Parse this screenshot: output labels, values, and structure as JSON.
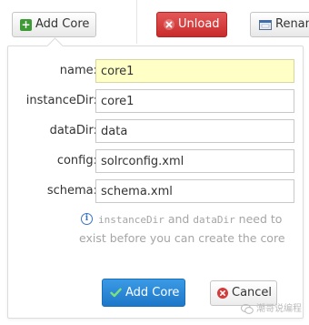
{
  "toolbar": {
    "add_core_label": "Add Core",
    "unload_label": "Unload",
    "rename_label": "Rename"
  },
  "form": {
    "fields": [
      {
        "label": "name:",
        "value": "core1"
      },
      {
        "label": "instanceDir:",
        "value": "core1"
      },
      {
        "label": "dataDir:",
        "value": "data"
      },
      {
        "label": "config:",
        "value": "solrconfig.xml"
      },
      {
        "label": "schema:",
        "value": "schema.xml"
      }
    ],
    "hint": {
      "code1": "instanceDir",
      "and": " and ",
      "code2": "dataDir",
      "rest": " need to exist before you can create the core"
    },
    "submit_label": "Add Core",
    "cancel_label": "Cancel"
  },
  "watermark": "潮哥说编程",
  "colors": {
    "unload_bg": "#d33c3c",
    "primary_bg": "#2a86d6",
    "name_highlight": "#ffffc6",
    "hint_text": "#a5a5a5",
    "info_icon": "#3c73c0"
  }
}
